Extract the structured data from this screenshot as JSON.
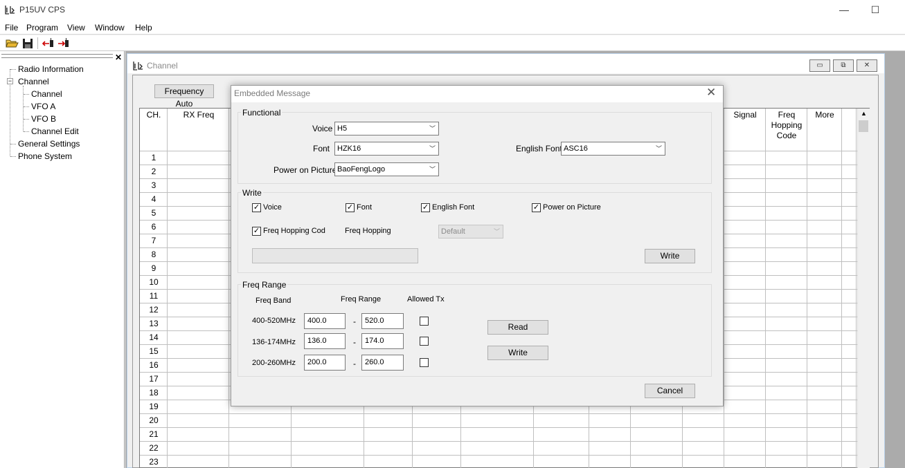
{
  "app": {
    "title": "P15UV CPS"
  },
  "menu": [
    "File",
    "Program",
    "View",
    "Window",
    "Help"
  ],
  "tree": {
    "items": [
      {
        "label": "Radio Information"
      },
      {
        "label": "Channel"
      },
      {
        "label": "Channel"
      },
      {
        "label": "VFO A"
      },
      {
        "label": "VFO B"
      },
      {
        "label": "Channel Edit"
      },
      {
        "label": "General Settings"
      },
      {
        "label": "Phone System"
      }
    ]
  },
  "channel_window": {
    "title": "Channel",
    "freq_button": "Frequency Auto",
    "columns": [
      "CH.",
      "RX Freq",
      "Signal",
      "Freq Hopping Code",
      "More"
    ],
    "rows": [
      "1",
      "2",
      "3",
      "4",
      "5",
      "6",
      "7",
      "8",
      "9",
      "10",
      "11",
      "12",
      "13",
      "14",
      "15",
      "16",
      "17",
      "18",
      "19",
      "20",
      "21",
      "22",
      "23"
    ]
  },
  "dialog": {
    "title": "Embedded Message",
    "functional": {
      "label": "Functional",
      "voice_label": "Voice",
      "voice_value": "H5",
      "font_label": "Font",
      "font_value": "HZK16",
      "english_font_label": "English Font",
      "english_font_value": "ASC16",
      "power_label": "Power on Picture",
      "power_value": "BaoFengLogo"
    },
    "write": {
      "label": "Write",
      "cb_voice": "Voice",
      "cb_font": "Font",
      "cb_english": "English Font",
      "cb_power": "Power on Picture",
      "cb_hopping": "Freq Hopping Code",
      "freq_hopping_label": "Freq Hopping",
      "freq_hopping_value": "Default",
      "write_button": "Write"
    },
    "range": {
      "label": "Freq Range",
      "col_band": "Freq Band",
      "col_range": "Freq Range",
      "col_allowed": "Allowed Tx",
      "rows": [
        {
          "band": "400-520MHz",
          "low": "400.0",
          "dash": "-",
          "high": "520.0"
        },
        {
          "band": "136-174MHz",
          "low": "136.0",
          "dash": "-",
          "high": "174.0"
        },
        {
          "band": "200-260MHz",
          "low": "200.0",
          "dash": "-",
          "high": "260.0"
        }
      ],
      "read_button": "Read",
      "write_button": "Write"
    },
    "cancel_button": "Cancel"
  }
}
